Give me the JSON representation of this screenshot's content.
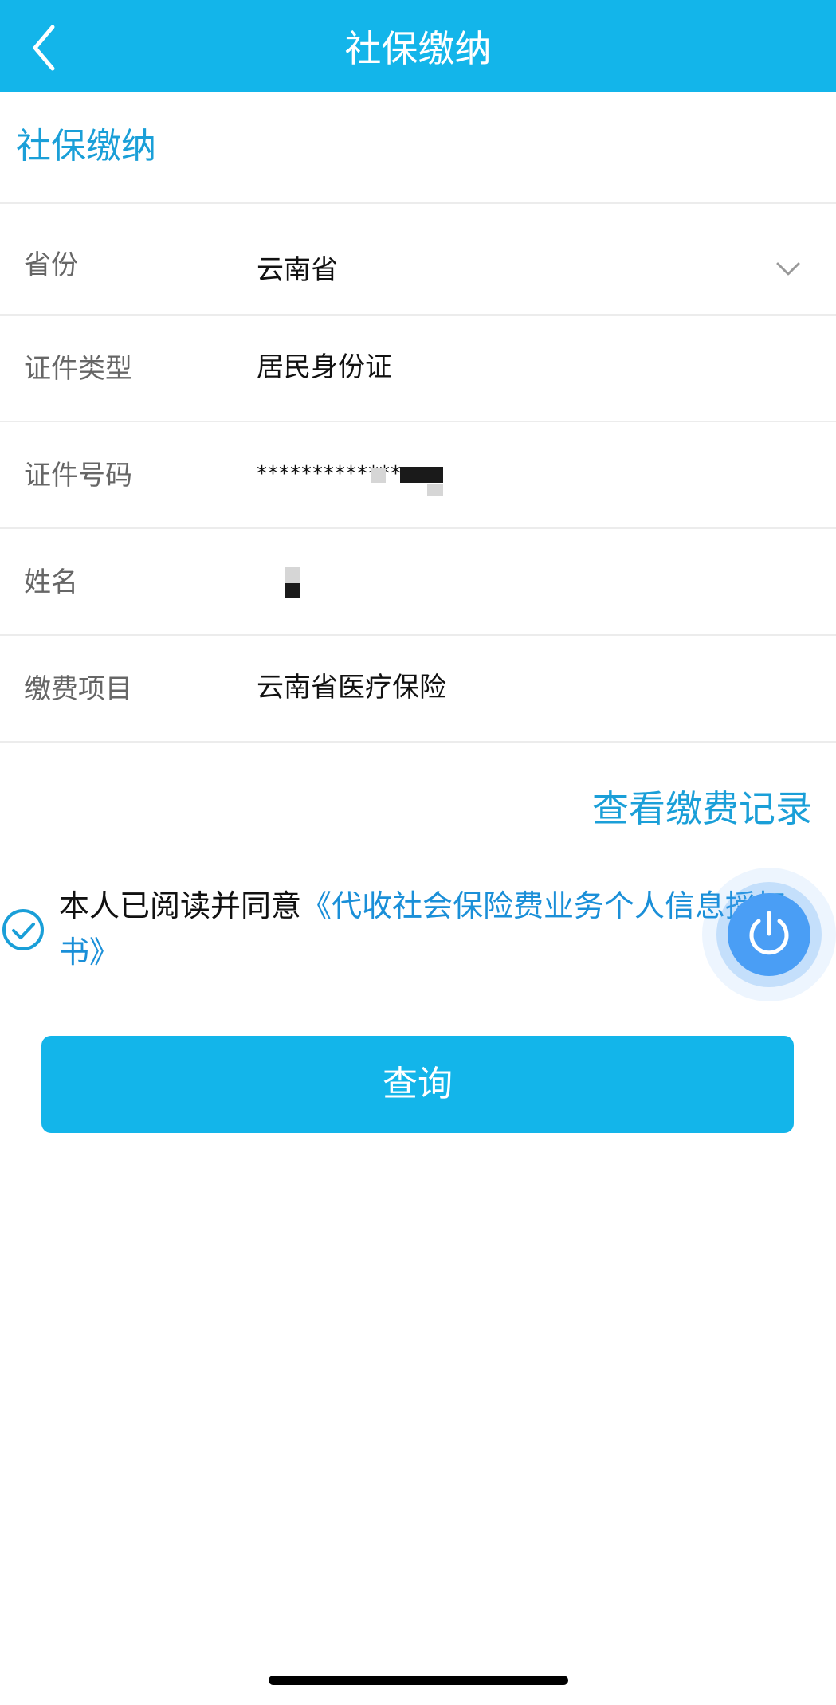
{
  "header": {
    "title": "社保缴纳",
    "back_icon": "chevron-left-icon"
  },
  "section": {
    "title": "社保缴纳"
  },
  "form": {
    "province": {
      "label": "省份",
      "value": "云南省",
      "icon": "chevron-down-icon"
    },
    "id_type": {
      "label": "证件类型",
      "value": "居民身份证"
    },
    "id_number": {
      "label": "证件号码",
      "value": "*************"
    },
    "name": {
      "label": "姓名",
      "value": ""
    },
    "item": {
      "label": "缴费项目",
      "value": "云南省医疗保险"
    }
  },
  "links": {
    "records": "查看缴费记录"
  },
  "agreement": {
    "checked": true,
    "prefix": "本人已阅读并同意",
    "link": "《代收社会保险费业务个人信息授权书》"
  },
  "actions": {
    "query": "查询",
    "float_icon": "power-icon"
  },
  "colors": {
    "primary": "#13b5ea",
    "link": "#1a9fd8",
    "float_button": "#4a9ef5"
  }
}
